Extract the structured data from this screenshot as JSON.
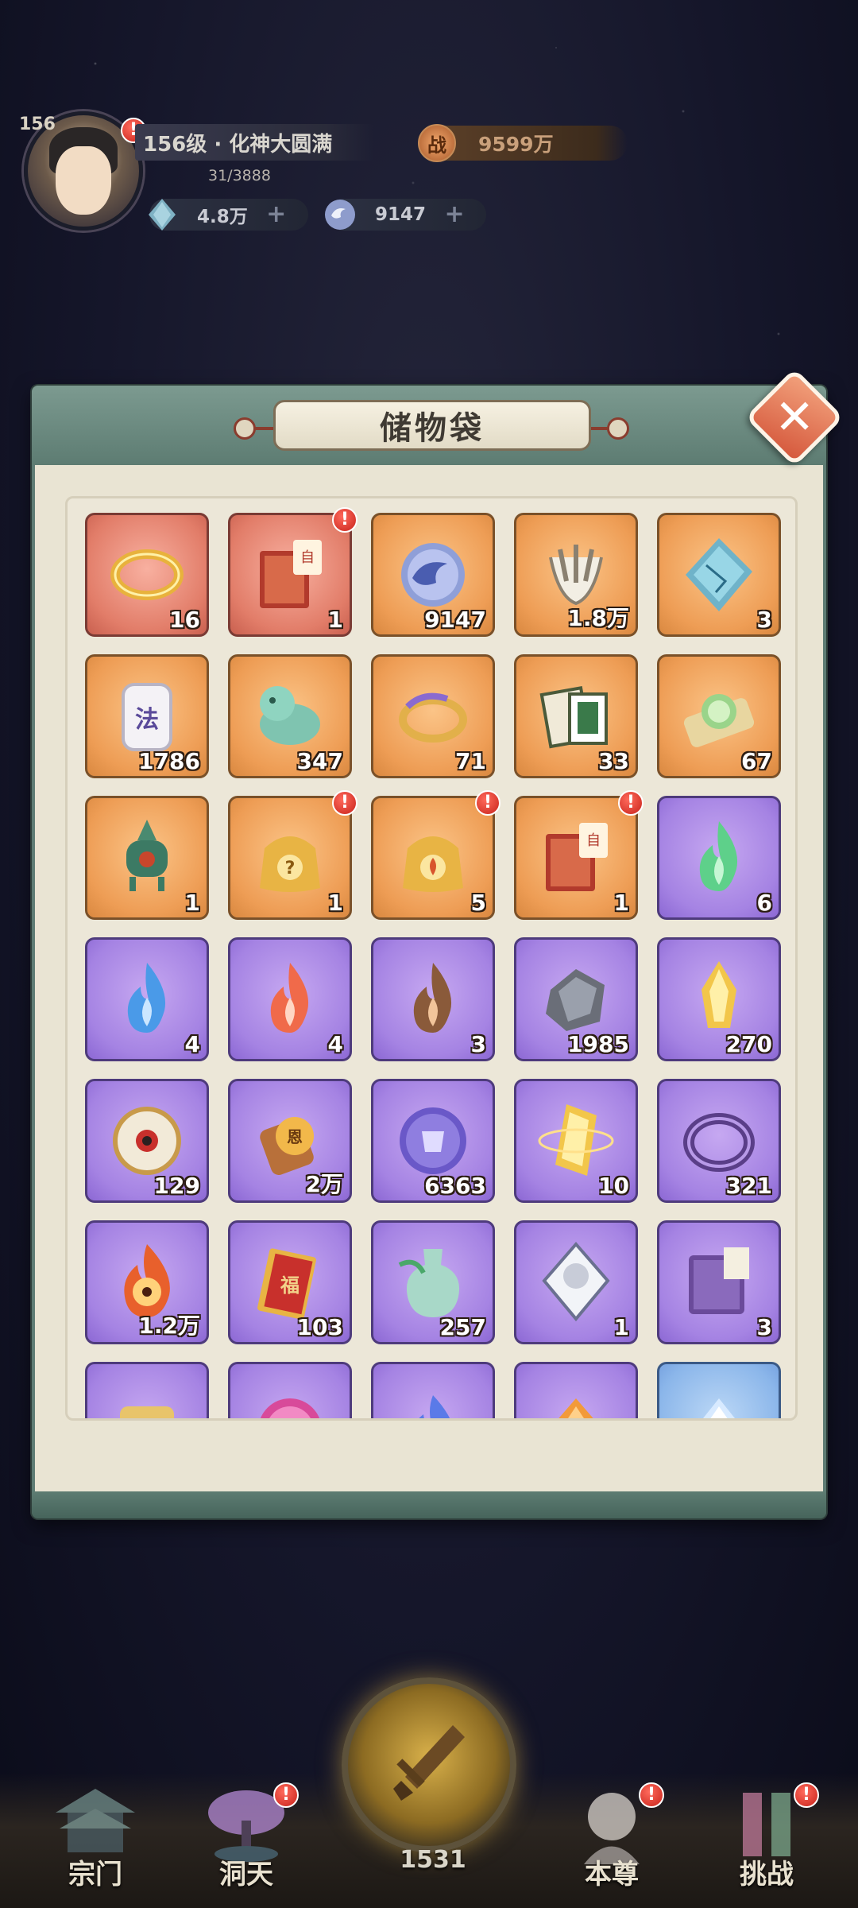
{
  "player": {
    "level": "156",
    "rank_text": "156级 · 化神大圆满",
    "exp_text": "31/3888",
    "power_symbol": "战",
    "power_value": "9599万",
    "spirit_stone": "4.8万",
    "coins": "9147",
    "plus": "+",
    "alert": "!"
  },
  "panel": {
    "title": "储物袋",
    "close_label": "✕"
  },
  "items": [
    {
      "rarity": "red",
      "icon": "golden-ring-icon",
      "qty": "16",
      "alert": false
    },
    {
      "rarity": "red",
      "icon": "choice-book-icon",
      "qty": "1",
      "alert": true
    },
    {
      "rarity": "gold",
      "icon": "spirit-coin-icon",
      "qty": "9147",
      "alert": false
    },
    {
      "rarity": "gold",
      "icon": "beast-claw-icon",
      "qty": "1.8万",
      "alert": false
    },
    {
      "rarity": "gold",
      "icon": "ice-crystal-icon",
      "qty": "3",
      "alert": false
    },
    {
      "rarity": "gold",
      "icon": "law-token-icon",
      "qty": "1786",
      "alert": false
    },
    {
      "rarity": "gold",
      "icon": "jade-lion-icon",
      "qty": "347",
      "alert": false
    },
    {
      "rarity": "gold",
      "icon": "dragon-bracelet-icon",
      "qty": "71",
      "alert": false
    },
    {
      "rarity": "gold",
      "icon": "scripture-book-icon",
      "qty": "33",
      "alert": false
    },
    {
      "rarity": "gold",
      "icon": "orb-scroll-icon",
      "qty": "67",
      "alert": false
    },
    {
      "rarity": "gold",
      "icon": "bronze-censer-icon",
      "qty": "1",
      "alert": false
    },
    {
      "rarity": "gold",
      "icon": "mystery-bag-icon",
      "qty": "1",
      "alert": true
    },
    {
      "rarity": "gold",
      "icon": "fire-bag-icon",
      "qty": "5",
      "alert": true
    },
    {
      "rarity": "gold",
      "icon": "choice-book-icon",
      "qty": "1",
      "alert": true
    },
    {
      "rarity": "purple",
      "icon": "green-flame-icon",
      "qty": "6",
      "alert": false
    },
    {
      "rarity": "purple",
      "icon": "blue-flame-icon",
      "qty": "4",
      "alert": false
    },
    {
      "rarity": "purple",
      "icon": "red-flame-icon",
      "qty": "4",
      "alert": false
    },
    {
      "rarity": "purple",
      "icon": "brown-flame-icon",
      "qty": "3",
      "alert": false
    },
    {
      "rarity": "purple",
      "icon": "iron-ore-icon",
      "qty": "1985",
      "alert": false
    },
    {
      "rarity": "purple",
      "icon": "gold-crystal-icon",
      "qty": "270",
      "alert": false
    },
    {
      "rarity": "purple",
      "icon": "compass-disc-icon",
      "qty": "129",
      "alert": false
    },
    {
      "rarity": "purple",
      "icon": "merit-scroll-icon",
      "qty": "2万",
      "alert": false
    },
    {
      "rarity": "purple",
      "icon": "purple-orb-icon",
      "qty": "6363",
      "alert": false
    },
    {
      "rarity": "purple",
      "icon": "gold-shard-icon",
      "qty": "10",
      "alert": false
    },
    {
      "rarity": "purple",
      "icon": "purple-bangle-icon",
      "qty": "321",
      "alert": false
    },
    {
      "rarity": "purple",
      "icon": "spirit-fire-icon",
      "qty": "1.2万",
      "alert": false
    },
    {
      "rarity": "purple",
      "icon": "fortune-ticket-icon",
      "qty": "103",
      "alert": false
    },
    {
      "rarity": "purple",
      "icon": "jade-vase-icon",
      "qty": "257",
      "alert": false
    },
    {
      "rarity": "purple",
      "icon": "portrait-card-icon",
      "qty": "1",
      "alert": false
    },
    {
      "rarity": "purple",
      "icon": "purple-tome-icon",
      "qty": "3",
      "alert": false
    },
    {
      "rarity": "purple",
      "icon": "gold-plate-icon",
      "qty": "",
      "alert": false
    },
    {
      "rarity": "purple",
      "icon": "pink-orb-icon",
      "qty": "",
      "alert": false
    },
    {
      "rarity": "purple",
      "icon": "blue-fire-icon",
      "qty": "",
      "alert": false
    },
    {
      "rarity": "purple",
      "icon": "amber-crystal-icon",
      "qty": "",
      "alert": false
    },
    {
      "rarity": "blue",
      "icon": "ice-diamond-icon",
      "qty": "",
      "alert": false
    }
  ],
  "nav": {
    "sect": "宗门",
    "cave": "洞天",
    "self": "本尊",
    "challenge": "挑战",
    "center_count": "1531"
  },
  "colors": {
    "red_rarity": "#e27d69",
    "gold_rarity": "#ee9d55",
    "purple_rarity": "#a583e3",
    "blue_rarity": "#8bb6ea",
    "alert_red": "#d5362a",
    "panel_frame": "#5e7c74"
  }
}
